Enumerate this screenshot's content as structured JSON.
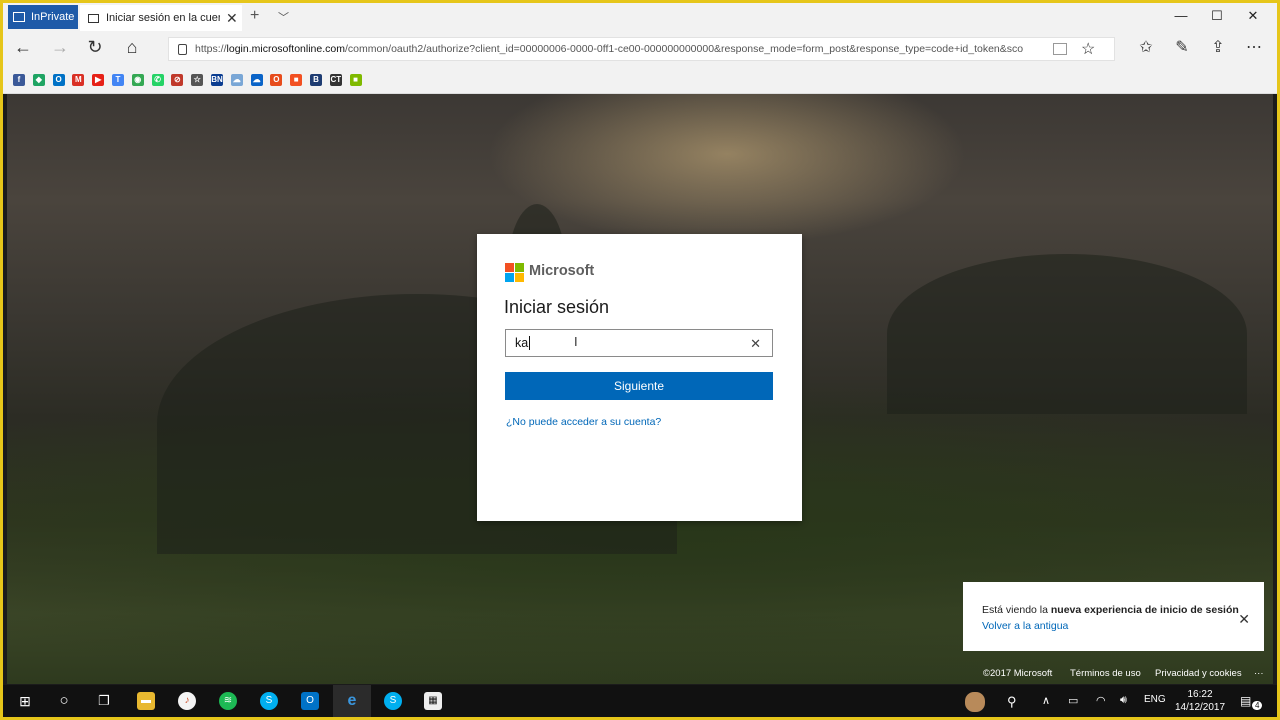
{
  "browser": {
    "inprivate_label": "InPrivate",
    "tab_title": "Iniciar sesión en la cuen",
    "url_prefix": "https://",
    "url_host": "login.microsoftonline.com",
    "url_rest": "/common/oauth2/authorize?client_id=00000006-0000-0ff1-ce00-000000000000&response_mode=form_post&response_type=code+id_token&sco",
    "window_minimize": "—",
    "window_maximize": "☐",
    "window_close": "✕"
  },
  "favorites": [
    {
      "icon": "facebook-icon",
      "glyph": "f",
      "color": "#3b5998"
    },
    {
      "icon": "google-drive-icon",
      "glyph": "◆",
      "color": "#1fa463"
    },
    {
      "icon": "outlook-icon",
      "glyph": "O",
      "color": "#0072c6"
    },
    {
      "icon": "gmail-icon",
      "glyph": "M",
      "color": "#d93025"
    },
    {
      "icon": "youtube-icon",
      "glyph": "▶",
      "color": "#e62117"
    },
    {
      "icon": "translate-icon",
      "glyph": "T",
      "color": "#4285f4"
    },
    {
      "icon": "maps-icon",
      "glyph": "◉",
      "color": "#34a853"
    },
    {
      "icon": "whatsapp-icon",
      "glyph": "✆",
      "color": "#25d366"
    },
    {
      "icon": "no-entry-icon",
      "glyph": "⊘",
      "color": "#c0392b"
    },
    {
      "icon": "favorite-star-icon",
      "glyph": "☆",
      "color": "#555555"
    },
    {
      "icon": "bn-icon",
      "glyph": "BN",
      "color": "#0b3d91"
    },
    {
      "icon": "cloud-icon",
      "glyph": "☁",
      "color": "#7aa7d6"
    },
    {
      "icon": "onedrive-icon",
      "glyph": "☁",
      "color": "#0a64c8"
    },
    {
      "icon": "office-icon",
      "glyph": "O",
      "color": "#e74c1c"
    },
    {
      "icon": "windows-icon",
      "glyph": "■",
      "color": "#f25022"
    },
    {
      "icon": "b-icon",
      "glyph": "B",
      "color": "#1e3c72"
    },
    {
      "icon": "ct-icon",
      "glyph": "CT",
      "color": "#333333"
    },
    {
      "icon": "microsoft-icon",
      "glyph": "■",
      "color": "#7fba00"
    }
  ],
  "login": {
    "brand": "Microsoft",
    "title": "Iniciar sesión",
    "email_value": "ka",
    "clear_glyph": "✕",
    "next_label": "Siguiente",
    "cant_access": "¿No puede acceder a su cuenta?"
  },
  "notice": {
    "text_plain": "Está viendo la ",
    "text_bold": "nueva experiencia de inicio de sesión",
    "link": "Volver a la antigua",
    "close_glyph": "✕"
  },
  "footer": {
    "copyright": "©2017 Microsoft",
    "terms": "Términos de uso",
    "privacy": "Privacidad y cookies",
    "more": "···"
  },
  "taskbar": {
    "language": "ENG",
    "time": "16:22",
    "date": "14/12/2017",
    "notifications_count": "4"
  }
}
